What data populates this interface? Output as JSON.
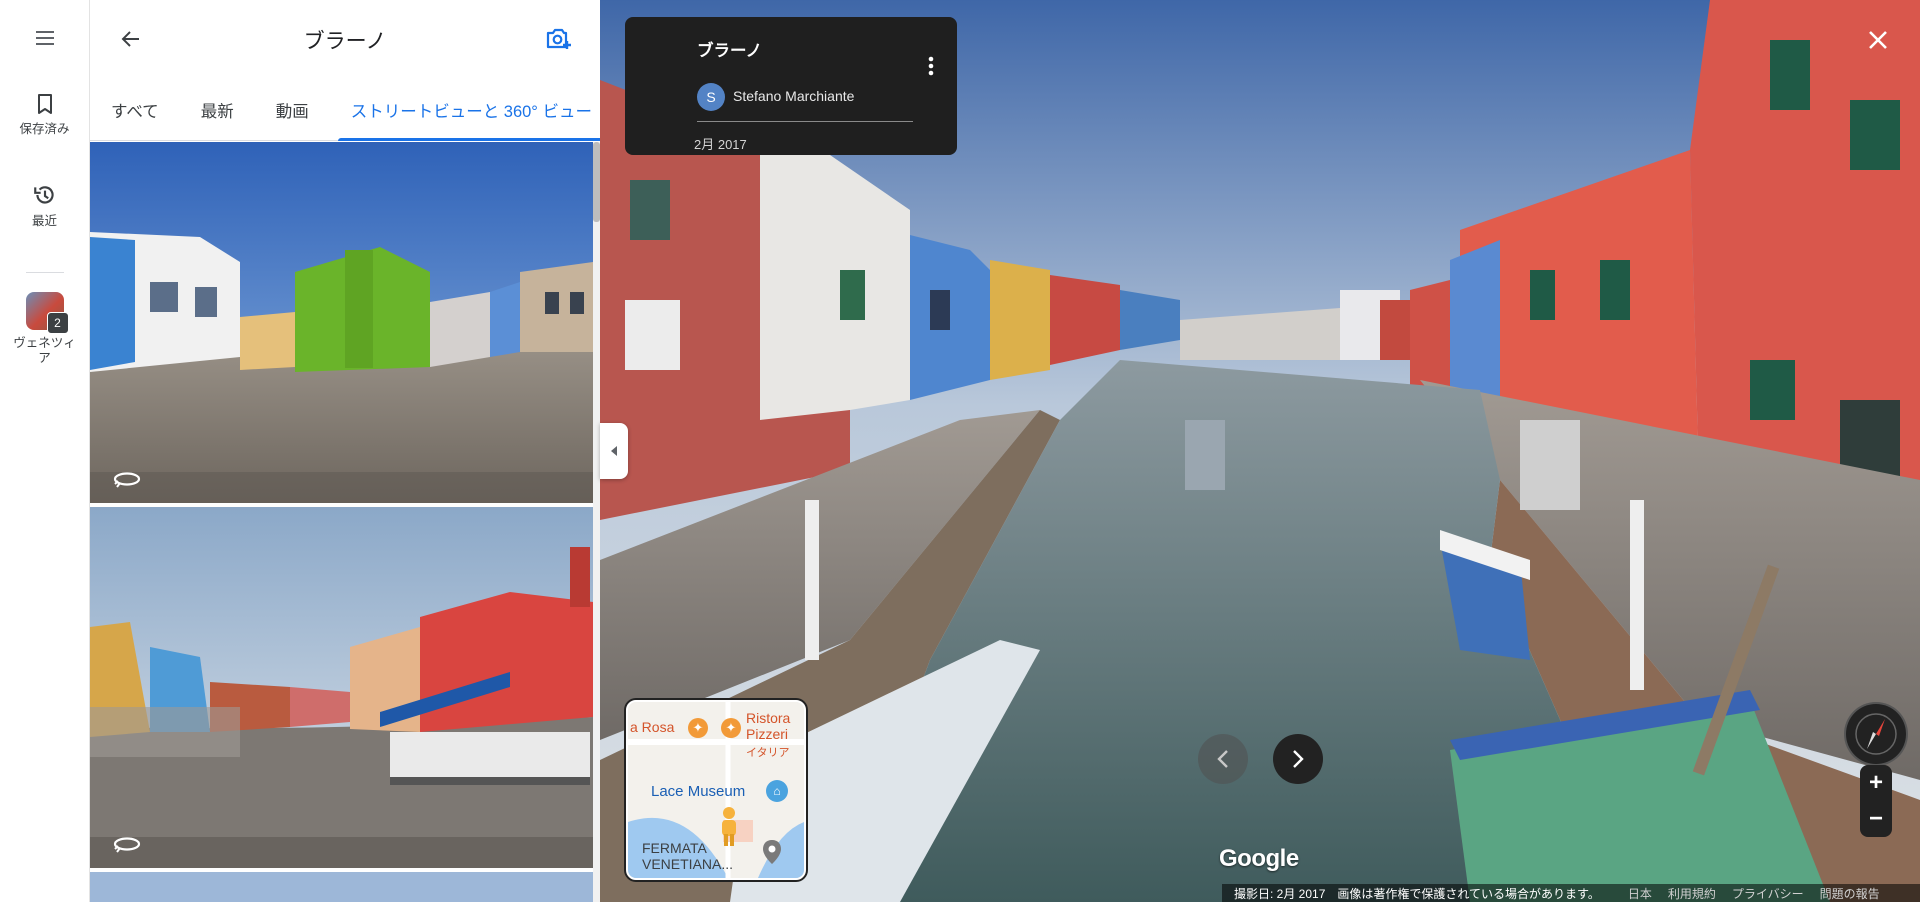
{
  "rail": {
    "saved_label": "保存済み",
    "recent_label": "最近",
    "place_label": "ヴェネツィア",
    "place_count": "2"
  },
  "panel": {
    "title": "ブラーノ",
    "tabs": [
      "すべて",
      "最新",
      "動画",
      "ストリートビューと 360° ビュー"
    ]
  },
  "info_card": {
    "title": "ブラーノ",
    "avatar_letter": "S",
    "author": "Stefano Marchiante",
    "date": "2月 2017"
  },
  "minimap": {
    "label_rosa": "a Rosa",
    "label_ristorante": "Ristora",
    "label_pizzeria": "Pizzeri",
    "label_italian": "イタリア",
    "label_museum": "Lace Museum",
    "label_fermata": "FERMATA",
    "label_venetiana": "VENETIANA..."
  },
  "google_logo": "Google",
  "footer": {
    "capture_date": "撮影日: 2月 2017",
    "copyright": "画像は著作権で保護されている場合があります。",
    "country": "日本",
    "terms": "利用規約",
    "privacy": "プライバシー",
    "report": "問題の報告"
  },
  "zoom": {
    "plus": "+",
    "minus": "−"
  },
  "colors": {
    "accent": "#1a73e8",
    "card_bg": "#1f1f1f",
    "avatar": "#5383c5"
  }
}
